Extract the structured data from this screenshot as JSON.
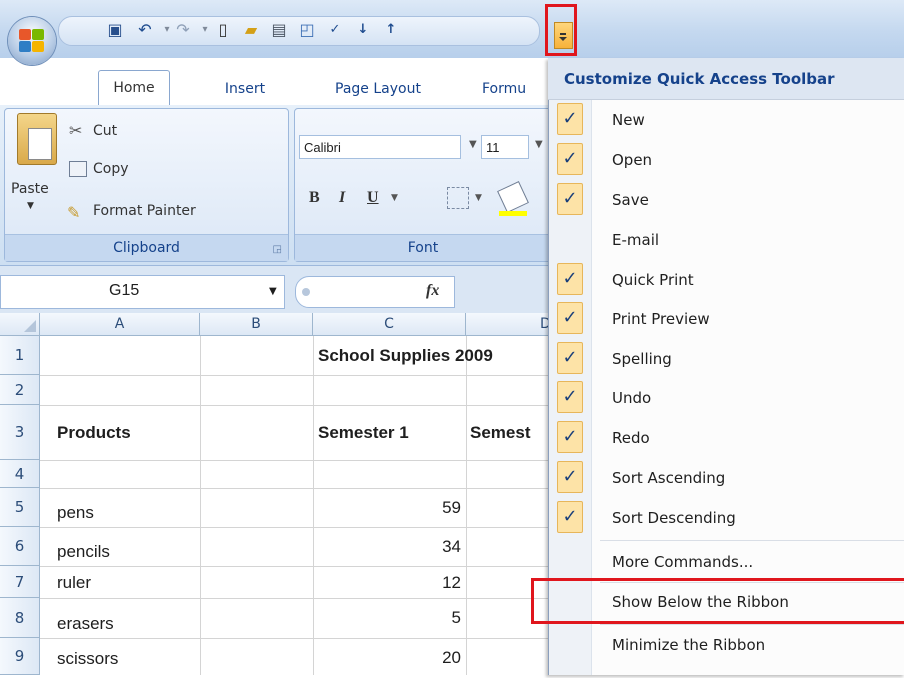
{
  "tabs": {
    "home": "Home",
    "insert": "Insert",
    "page_layout": "Page Layout",
    "formulas": "Formu"
  },
  "clipboard": {
    "paste": "Paste",
    "cut": "Cut",
    "copy": "Copy",
    "format_painter": "Format Painter",
    "group_label": "Clipboard"
  },
  "font": {
    "name": "Calibri",
    "size": "11",
    "bold": "B",
    "italic": "I",
    "underline": "U",
    "group_label": "Font"
  },
  "formula_bar": {
    "name_box": "G15",
    "fx": "fx"
  },
  "columns": [
    "A",
    "B",
    "C",
    "D"
  ],
  "rows": [
    {
      "num": "1",
      "a": "",
      "c": "School Supplies 2009",
      "d": ""
    },
    {
      "num": "2",
      "a": "",
      "c": "",
      "d": ""
    },
    {
      "num": "3",
      "a": "Products",
      "c": "Semester 1",
      "d": "Semest"
    },
    {
      "num": "4",
      "a": "",
      "c": "",
      "d": ""
    },
    {
      "num": "5",
      "a": "pens",
      "c": "59",
      "d": ""
    },
    {
      "num": "6",
      "a": "pencils",
      "c": "34",
      "d": ""
    },
    {
      "num": "7",
      "a": "ruler",
      "c": "12",
      "d": ""
    },
    {
      "num": "8",
      "a": "erasers",
      "c": "5",
      "d": ""
    },
    {
      "num": "9",
      "a": "scissors",
      "c": "20",
      "d": ""
    }
  ],
  "menu": {
    "title": "Customize Quick Access Toolbar",
    "check_mark": "✓",
    "items": [
      {
        "label": "New",
        "checked": true
      },
      {
        "label": "Open",
        "checked": true
      },
      {
        "label": "Save",
        "checked": true
      },
      {
        "label": "E-mail",
        "checked": false
      },
      {
        "label": "Quick Print",
        "checked": true
      },
      {
        "label": "Print Preview",
        "checked": true
      },
      {
        "label": "Spelling",
        "checked": true
      },
      {
        "label": "Undo",
        "checked": true
      },
      {
        "label": "Redo",
        "checked": true
      },
      {
        "label": "Sort Ascending",
        "checked": true
      },
      {
        "label": "Sort Descending",
        "checked": true
      }
    ],
    "more_commands": "More Commands...",
    "show_below": "Show Below the Ribbon",
    "minimize": "Minimize the Ribbon"
  },
  "colors": {
    "highlight": "#e0161d",
    "ribbon": "#dbe7f6",
    "menu_check": "#fde3a7"
  }
}
